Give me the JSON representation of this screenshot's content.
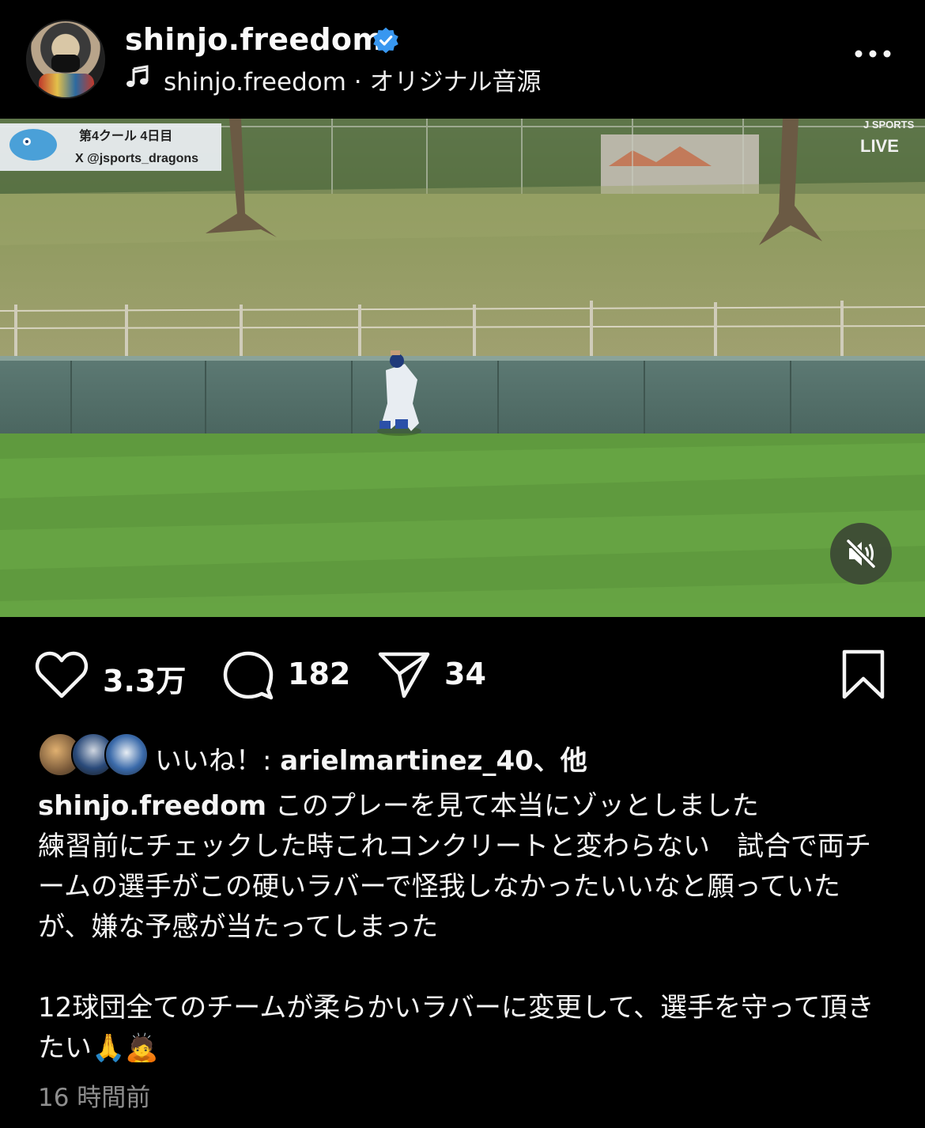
{
  "header": {
    "username": "shinjo.freedom",
    "audio": "shinjo.freedom · オリジナル音源",
    "more_label": "•••"
  },
  "video": {
    "overlay_banner_line1": "第4クール 4日目",
    "overlay_banner_line2": "X @jsports_dragons",
    "overlay_logo": "J SPORTS",
    "overlay_live": "LIVE"
  },
  "actions": {
    "likes": "3.3万",
    "comments": "182",
    "shares": "34"
  },
  "likes_line": {
    "prefix": "いいね！: ",
    "user": "arielmartinez_40、他"
  },
  "caption": {
    "username": "shinjo.freedom",
    "line1": " このプレーを見て本当にゾッとしました",
    "body": "練習前にチェックした時これコンクリートと変わらない　試合で両チームの選手がこの硬いラバーで怪我しなかったいいなと願っていたが、嫌な予感が当たってしまった\n\n12球団全てのチームが柔らかいラバーに変更して、選手を守って頂きたい🙏🙇"
  },
  "timestamp": "16 時間前",
  "colors": {
    "background": "#000000",
    "text": "#f5f5f5",
    "muted": "#8e8e8e",
    "verified": "#3897f0"
  }
}
